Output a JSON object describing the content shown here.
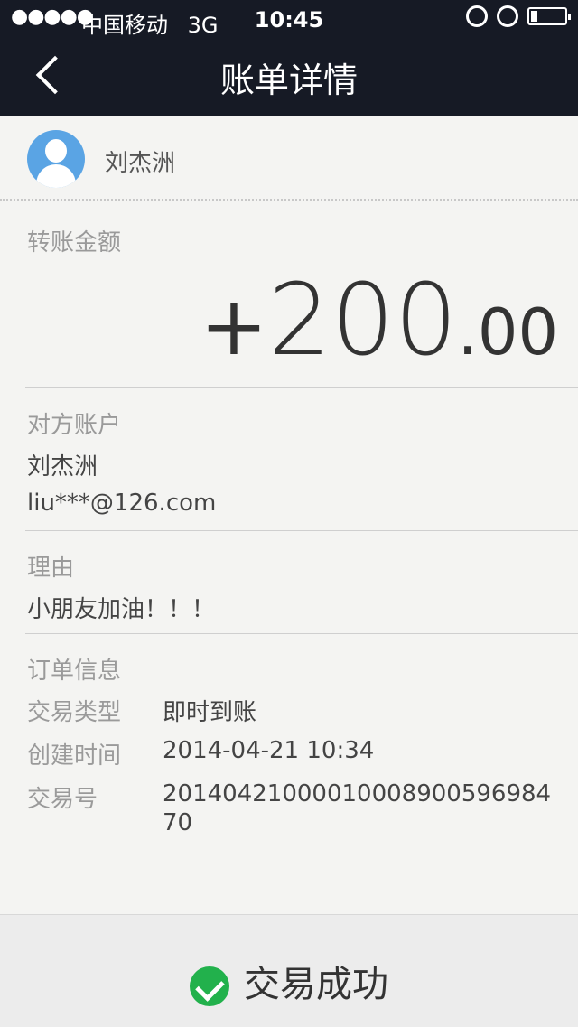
{
  "status_bar": {
    "carrier": "中国移动",
    "network": "3G",
    "time": "10:45",
    "battery_level": 0.2,
    "signal_bars": 5
  },
  "nav": {
    "title": "账单详情",
    "back_icon": "chevron-left-icon"
  },
  "payer": {
    "name": "刘杰洲",
    "avatar_icon": "user-avatar-icon",
    "avatar_color": "#5aa4e4"
  },
  "amount": {
    "label": "转账金额",
    "sign": "+",
    "integer": "200",
    "decimal": ".00"
  },
  "counterparty": {
    "label": "对方账户",
    "name": "刘杰洲",
    "account": "liu***@126.com"
  },
  "reason": {
    "label": "理由",
    "text": "小朋友加油！！！"
  },
  "order": {
    "label": "订单信息",
    "type_label": "交易类型",
    "type_value": "即时到账",
    "created_label": "创建时间",
    "created_value": "2014-04-21 10:34",
    "tx_label": "交易号",
    "tx_value_line1": "20140421000010008900596984",
    "tx_value_line2": "70"
  },
  "footer": {
    "status_text": "交易成功",
    "status_icon": "check-circle-icon",
    "status_color": "#22b14c"
  }
}
